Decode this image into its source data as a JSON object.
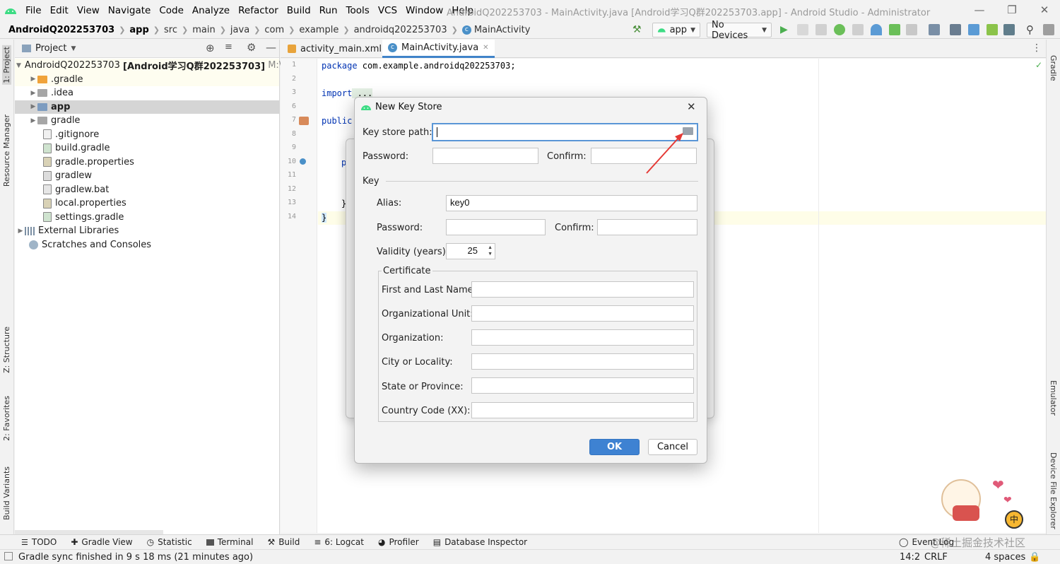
{
  "menubar": {
    "items": [
      "File",
      "Edit",
      "View",
      "Navigate",
      "Code",
      "Analyze",
      "Refactor",
      "Build",
      "Run",
      "Tools",
      "VCS",
      "Window",
      "Help"
    ],
    "window_title": "AndroidQ202253703 - MainActivity.java [Android学习Q群202253703.app] - Android Studio - Administrator"
  },
  "navbar": {
    "crumbs": [
      "AndroidQ202253703",
      "app",
      "src",
      "main",
      "java",
      "com",
      "example",
      "androidq202253703",
      "MainActivity"
    ],
    "run_config": "app",
    "device": "No Devices"
  },
  "left_stripe": {
    "tabs": [
      "1: Project",
      "Resource Manager",
      "Z: Structure",
      "2: Favorites",
      "Build Variants"
    ]
  },
  "right_stripe": {
    "tabs": [
      "Gradle",
      "Emulator",
      "Device File Explorer"
    ]
  },
  "project_panel": {
    "title": "Project",
    "root": {
      "name": "AndroidQ202253703",
      "bold_suffix": "[Android学习Q群202253703]",
      "path": "M:\\And"
    },
    "items": [
      {
        "label": ".gradle",
        "kind": "folder-orange"
      },
      {
        "label": ".idea",
        "kind": "folder-gray"
      },
      {
        "label": "app",
        "kind": "folder-module"
      },
      {
        "label": "gradle",
        "kind": "folder-gray"
      },
      {
        "label": ".gitignore",
        "kind": "file"
      },
      {
        "label": "build.gradle",
        "kind": "file"
      },
      {
        "label": "gradle.properties",
        "kind": "file"
      },
      {
        "label": "gradlew",
        "kind": "file"
      },
      {
        "label": "gradlew.bat",
        "kind": "file"
      },
      {
        "label": "local.properties",
        "kind": "file"
      },
      {
        "label": "settings.gradle",
        "kind": "file"
      }
    ],
    "external_libraries": "External Libraries",
    "scratches": "Scratches and Consoles"
  },
  "editor": {
    "tabs": [
      "activity_main.xml",
      "MainActivity.java"
    ],
    "line_numbers": [
      "1",
      "2",
      "3",
      "6",
      "7",
      "8",
      "9",
      "10",
      "11",
      "12",
      "13",
      "14"
    ],
    "line1_keyword": "package",
    "line1_rest": " com.example.androidq202253703;",
    "line3_keyword": "import",
    "line3_rest": " ...",
    "line7": "public",
    "line10": "p",
    "line13": "}",
    "line14": "}"
  },
  "dialog": {
    "title": "New Key Store",
    "key_store_path_label": "Key store path:",
    "key_store_path_value": "",
    "password_label": "Password:",
    "confirm_label": "Confirm:",
    "key_section": "Key",
    "alias_label": "Alias:",
    "alias_value": "key0",
    "key_password_label": "Password:",
    "key_confirm_label": "Confirm:",
    "validity_label": "Validity (years):",
    "validity_value": "25",
    "certificate_section": "Certificate",
    "cert_fields": [
      "First and Last Name:",
      "Organizational Unit:",
      "Organization:",
      "City or Locality:",
      "State or Province:",
      "Country Code (XX):"
    ],
    "ok_label": "OK",
    "cancel_label": "Cancel"
  },
  "bottom_tabs": [
    "TODO",
    "Gradle View",
    "Statistic",
    "Terminal",
    "Build",
    "6: Logcat",
    "Profiler",
    "Database Inspector"
  ],
  "bottom_right": "Event Log",
  "statusbar": {
    "message": "Gradle sync finished in 9 s 18 ms (21 minutes ago)",
    "position": "14:2",
    "line_sep": "CRLF",
    "indent": "4 spaces"
  },
  "watermark": "@稀土掘金技术社区",
  "colors": {
    "android_green": "#3ddc84",
    "accent_blue": "#3e82d2",
    "arrow_red": "#e53935"
  }
}
